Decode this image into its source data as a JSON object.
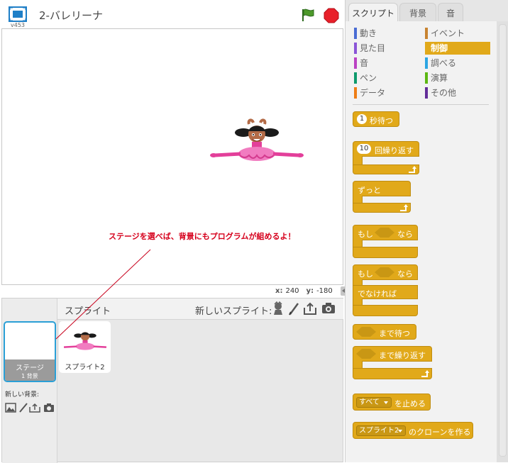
{
  "stage": {
    "version": "v453",
    "project_title": "2-バレリーナ",
    "annotation": "ステージを選べば、背景にもプログラムが組めるよ！",
    "x_label": "x:",
    "x_value": "240",
    "y_label": "y:",
    "y_value": "-180"
  },
  "sprites": {
    "header": "スプライト",
    "new_sprite_label": "新しいスプライト:",
    "stage_thumb_title": "ステージ",
    "stage_thumb_sub": "1 背景",
    "new_bg_label": "新しい背景:",
    "items": [
      {
        "name": "スプライト2"
      }
    ]
  },
  "tabs": [
    "スクリプト",
    "背景",
    "音"
  ],
  "categories": [
    {
      "label": "動き",
      "color": "#4a6cd4"
    },
    {
      "label": "イベント",
      "color": "#c88330"
    },
    {
      "label": "見た目",
      "color": "#8a55d7"
    },
    {
      "label": "制御",
      "color": "#e1a91a"
    },
    {
      "label": "音",
      "color": "#bb42c3"
    },
    {
      "label": "調べる",
      "color": "#2ca5e2"
    },
    {
      "label": "ペン",
      "color": "#0e9a6c"
    },
    {
      "label": "演算",
      "color": "#5cb712"
    },
    {
      "label": "データ",
      "color": "#ee7d16"
    },
    {
      "label": "その他",
      "color": "#632d99"
    }
  ],
  "blocks": {
    "wait_value": "1",
    "wait_text": "秒待つ",
    "repeat_value": "10",
    "repeat_text": "回繰り返す",
    "forever_text": "ずっと",
    "if_text": "もし",
    "then_text": "なら",
    "if2_text": "もし",
    "then2_text": "なら",
    "else_text": "でなければ",
    "wait_until_text": "まで待つ",
    "repeat_until_text": "まで繰り返す",
    "stop_option": "すべて",
    "stop_text": "を止める",
    "clone_option": "スプライト2",
    "clone_text": "のクローンを作る"
  },
  "colors": {
    "control": "#e1a91a",
    "selection": "#2a9fd6",
    "annotation": "#d6001c"
  }
}
